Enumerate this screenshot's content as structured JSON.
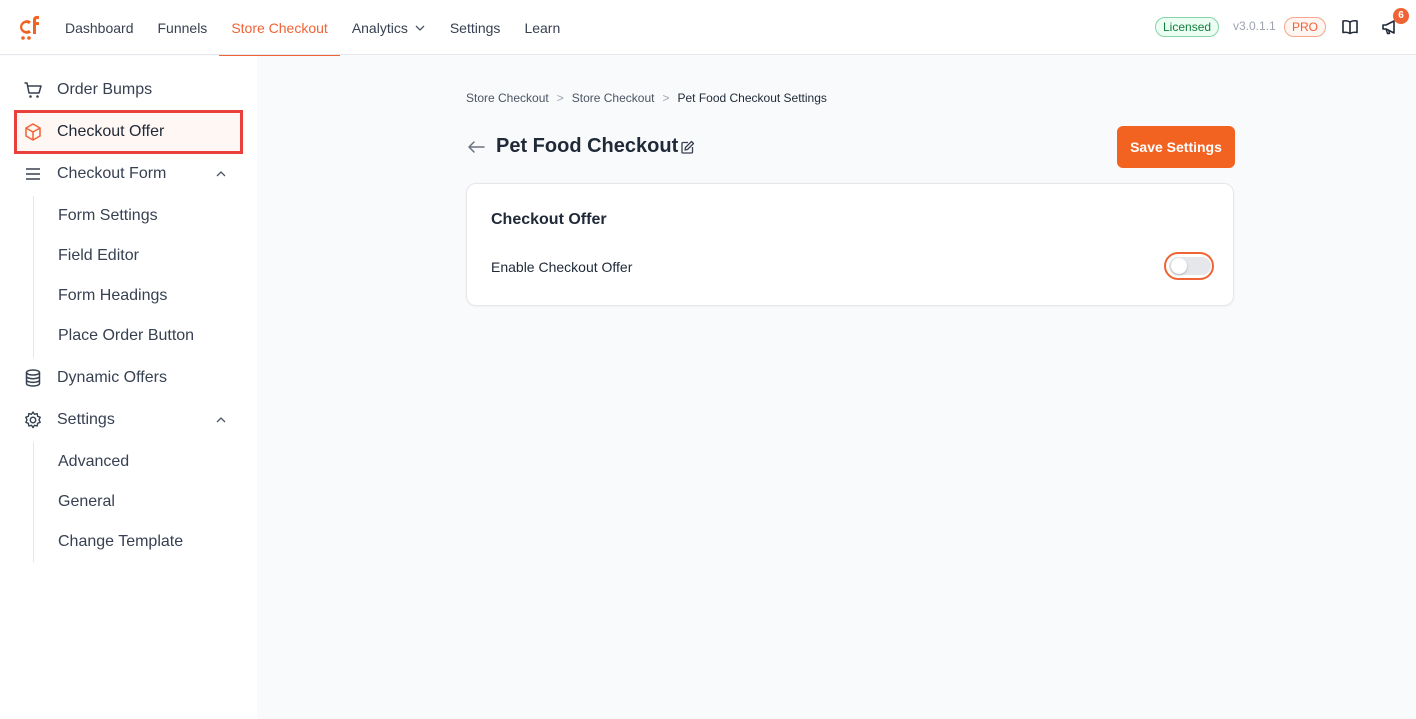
{
  "topbar": {
    "logo": "cartflows-logo",
    "nav": [
      {
        "label": "Dashboard"
      },
      {
        "label": "Funnels"
      },
      {
        "label": "Store Checkout"
      },
      {
        "label": "Analytics"
      },
      {
        "label": "Settings"
      },
      {
        "label": "Learn"
      }
    ],
    "license_badge": "Licensed",
    "version": "v3.0.1.1",
    "pro_badge": "PRO",
    "notification_count": "6",
    "accent_color": "#f06335"
  },
  "sidebar": {
    "items": [
      {
        "label": "Order Bumps",
        "icon": "cart-icon"
      },
      {
        "label": "Checkout Offer",
        "icon": "cube-icon"
      },
      {
        "label": "Checkout Form",
        "icon": "menu-lines-icon"
      },
      {
        "label": "Dynamic Offers",
        "icon": "database-icon"
      },
      {
        "label": "Settings",
        "icon": "gear-icon"
      }
    ],
    "checkout_form_sub": [
      "Form Settings",
      "Field Editor",
      "Form Headings",
      "Place Order Button"
    ],
    "settings_sub": [
      "Advanced",
      "General",
      "Change Template"
    ]
  },
  "breadcrumb": {
    "items": [
      "Store Checkout",
      "Store Checkout",
      "Pet Food Checkout Settings"
    ],
    "separator": ">"
  },
  "page": {
    "title": "Pet Food Checkout",
    "save_label": "Save Settings"
  },
  "card": {
    "title": "Checkout Offer",
    "toggle_label": "Enable Checkout Offer",
    "toggle_on": false
  }
}
